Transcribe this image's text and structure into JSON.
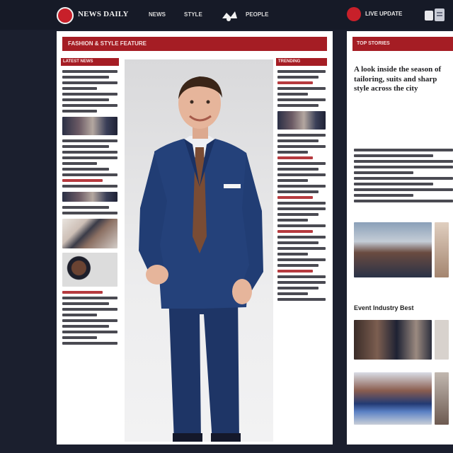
{
  "header": {
    "brand": "NEWS DAILY",
    "nav": [
      "NEWS",
      "STYLE",
      "PEOPLE"
    ],
    "right_label": "LIVE UPDATE",
    "accent_color": "#c8202a",
    "bg_color": "#161a27"
  },
  "main": {
    "header_text": "FASHION & STYLE FEATURE",
    "left_column_head": "LATEST NEWS",
    "right_column_head": "TRENDING"
  },
  "side": {
    "header_text": "TOP STORIES",
    "headline": "A look inside the season of tailoring, suits and sharp style across the city",
    "subhead": "Event Industry Best"
  },
  "icons": {
    "logo": "logo-circle",
    "nav_symbol": "pawprint-icon",
    "user": "user-icon"
  }
}
